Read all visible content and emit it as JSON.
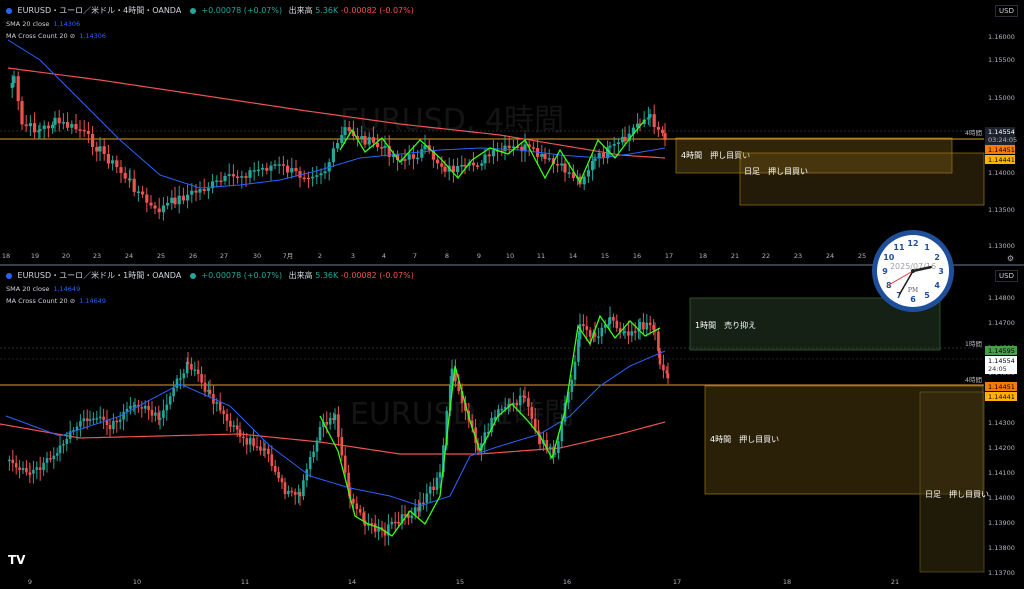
{
  "pane1": {
    "symbol": "EURUSD・ユーロ／米ドル・4時間・OANDA",
    "change": "+0.00078 (+0.07%)",
    "volume_label": "出来高",
    "volume_value": "5.36K",
    "vol_change": "-0.00082 (-0.07%)",
    "sma_label": "SMA 20 close",
    "sma_value": "1.14306",
    "ma_cross_label": "MA Cross Count 20",
    "ma_cross_value": "1.14306",
    "currency": "USD",
    "watermark": "EURUSD, 4時間",
    "price_ticks": [
      "1.16000",
      "1.15500",
      "1.15000",
      "1.14500",
      "1.14000",
      "1.13500",
      "1.13000"
    ],
    "time_ticks": [
      "18",
      "19",
      "20",
      "23",
      "24",
      "25",
      "26",
      "27",
      "30",
      "7月",
      "2",
      "3",
      "4",
      "7",
      "8",
      "9",
      "10",
      "11",
      "14",
      "15",
      "16",
      "17",
      "18",
      "21",
      "22",
      "23",
      "24",
      "25"
    ],
    "line_label": "4時間",
    "price_current": "1.14554",
    "countdown": "03:24:05",
    "price_a": "1.14451",
    "price_b": "1.14441",
    "zone1": "4時間　押し目買い",
    "zone2": "日足　押し目買い"
  },
  "pane2": {
    "symbol": "EURUSD・ユーロ／米ドル・1時間・OANDA",
    "change": "+0.00078 (+0.07%)",
    "volume_label": "出来高",
    "volume_value": "5.36K",
    "vol_change": "-0.00082 (-0.07%)",
    "sma_label": "SMA 20 close",
    "sma_value": "1.14649",
    "ma_cross_label": "MA Cross Count 20",
    "ma_cross_value": "1.14649",
    "currency": "USD",
    "watermark": "EURUSD, 1時間",
    "price_ticks": [
      "1.14800",
      "1.14700",
      "1.14600",
      "1.14500",
      "1.14400",
      "1.14300",
      "1.14200",
      "1.14100",
      "1.14000",
      "1.13900",
      "1.13800",
      "1.13700"
    ],
    "time_ticks": [
      "9",
      "10",
      "11",
      "14",
      "15",
      "16",
      "17",
      "18",
      "21"
    ],
    "line_label_1h": "1時間",
    "line_label_4h": "4時間",
    "price_green": "1.14595",
    "price_current": "1.14554",
    "countdown": "24:05",
    "price_a": "1.14451",
    "price_b": "1.14441",
    "zone_sell": "1時間　売り抑え",
    "zone1": "4時間　押し目買い",
    "zone2": "日足　押し目買い"
  },
  "clock": {
    "date": "2025/07/16",
    "ampm": "PM",
    "hour": 2,
    "minute": 35,
    "second": 40
  },
  "logo": "TV",
  "colors": {
    "up": "#26a69a",
    "down": "#ef5350",
    "sma": "#2962ff",
    "ma200": "#ef5350",
    "cross": "#39ff14",
    "zone_buy": "#8a6a1a",
    "zone_sell": "#2e4a2e",
    "bg": "#000000"
  }
}
